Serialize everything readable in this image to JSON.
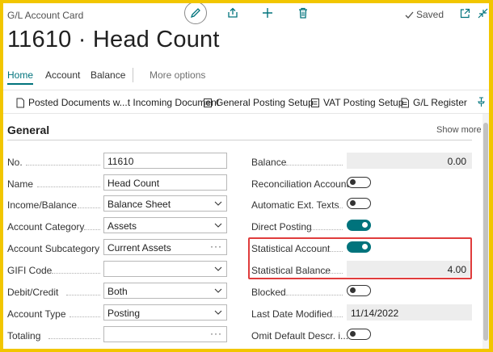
{
  "header": {
    "card_type": "G/L Account Card",
    "status": "Saved",
    "title": "11610 · Head Count"
  },
  "nav_tabs": [
    {
      "label": "Home",
      "active": true
    },
    {
      "label": "Account",
      "active": false
    },
    {
      "label": "Balance",
      "active": false
    },
    {
      "label": "More options",
      "active": false
    }
  ],
  "actions": [
    {
      "label": "Posted Documents w...t Incoming Document",
      "icon": "document-icon"
    },
    {
      "label": "General Posting Setup",
      "icon": "setup-icon"
    },
    {
      "label": "VAT Posting Setup",
      "icon": "setup-icon"
    },
    {
      "label": "G/L Register",
      "icon": "register-icon"
    }
  ],
  "general": {
    "title": "General",
    "show_more": "Show more",
    "left_fields": {
      "no": {
        "label": "No.",
        "value": "11610"
      },
      "name": {
        "label": "Name",
        "value": "Head Count"
      },
      "income_balance": {
        "label": "Income/Balance",
        "value": "Balance Sheet"
      },
      "account_category": {
        "label": "Account Category",
        "value": "Assets"
      },
      "account_subcategory": {
        "label": "Account Subcategory",
        "value": "Current Assets"
      },
      "gifi_code": {
        "label": "GIFI Code",
        "value": ""
      },
      "debit_credit": {
        "label": "Debit/Credit",
        "value": "Both"
      },
      "account_type": {
        "label": "Account Type",
        "value": "Posting"
      },
      "totaling": {
        "label": "Totaling",
        "value": ""
      }
    },
    "right_fields": {
      "balance": {
        "label": "Balance",
        "value": "0.00"
      },
      "reconciliation_account": {
        "label": "Reconciliation Account",
        "on": false
      },
      "automatic_ext_texts": {
        "label": "Automatic Ext. Texts",
        "on": false
      },
      "direct_posting": {
        "label": "Direct Posting",
        "on": true
      },
      "statistical_account": {
        "label": "Statistical Account",
        "on": true
      },
      "statistical_balance": {
        "label": "Statistical Balance",
        "value": "4.00"
      },
      "blocked": {
        "label": "Blocked",
        "on": false
      },
      "last_date_modified": {
        "label": "Last Date Modified",
        "value": "11/14/2022"
      },
      "omit_default_descr": {
        "label": "Omit Default Descr. i...",
        "on": false
      }
    }
  },
  "colors": {
    "accent": "#00737c",
    "highlight": "#e03c3c",
    "frame": "#f2c600"
  }
}
